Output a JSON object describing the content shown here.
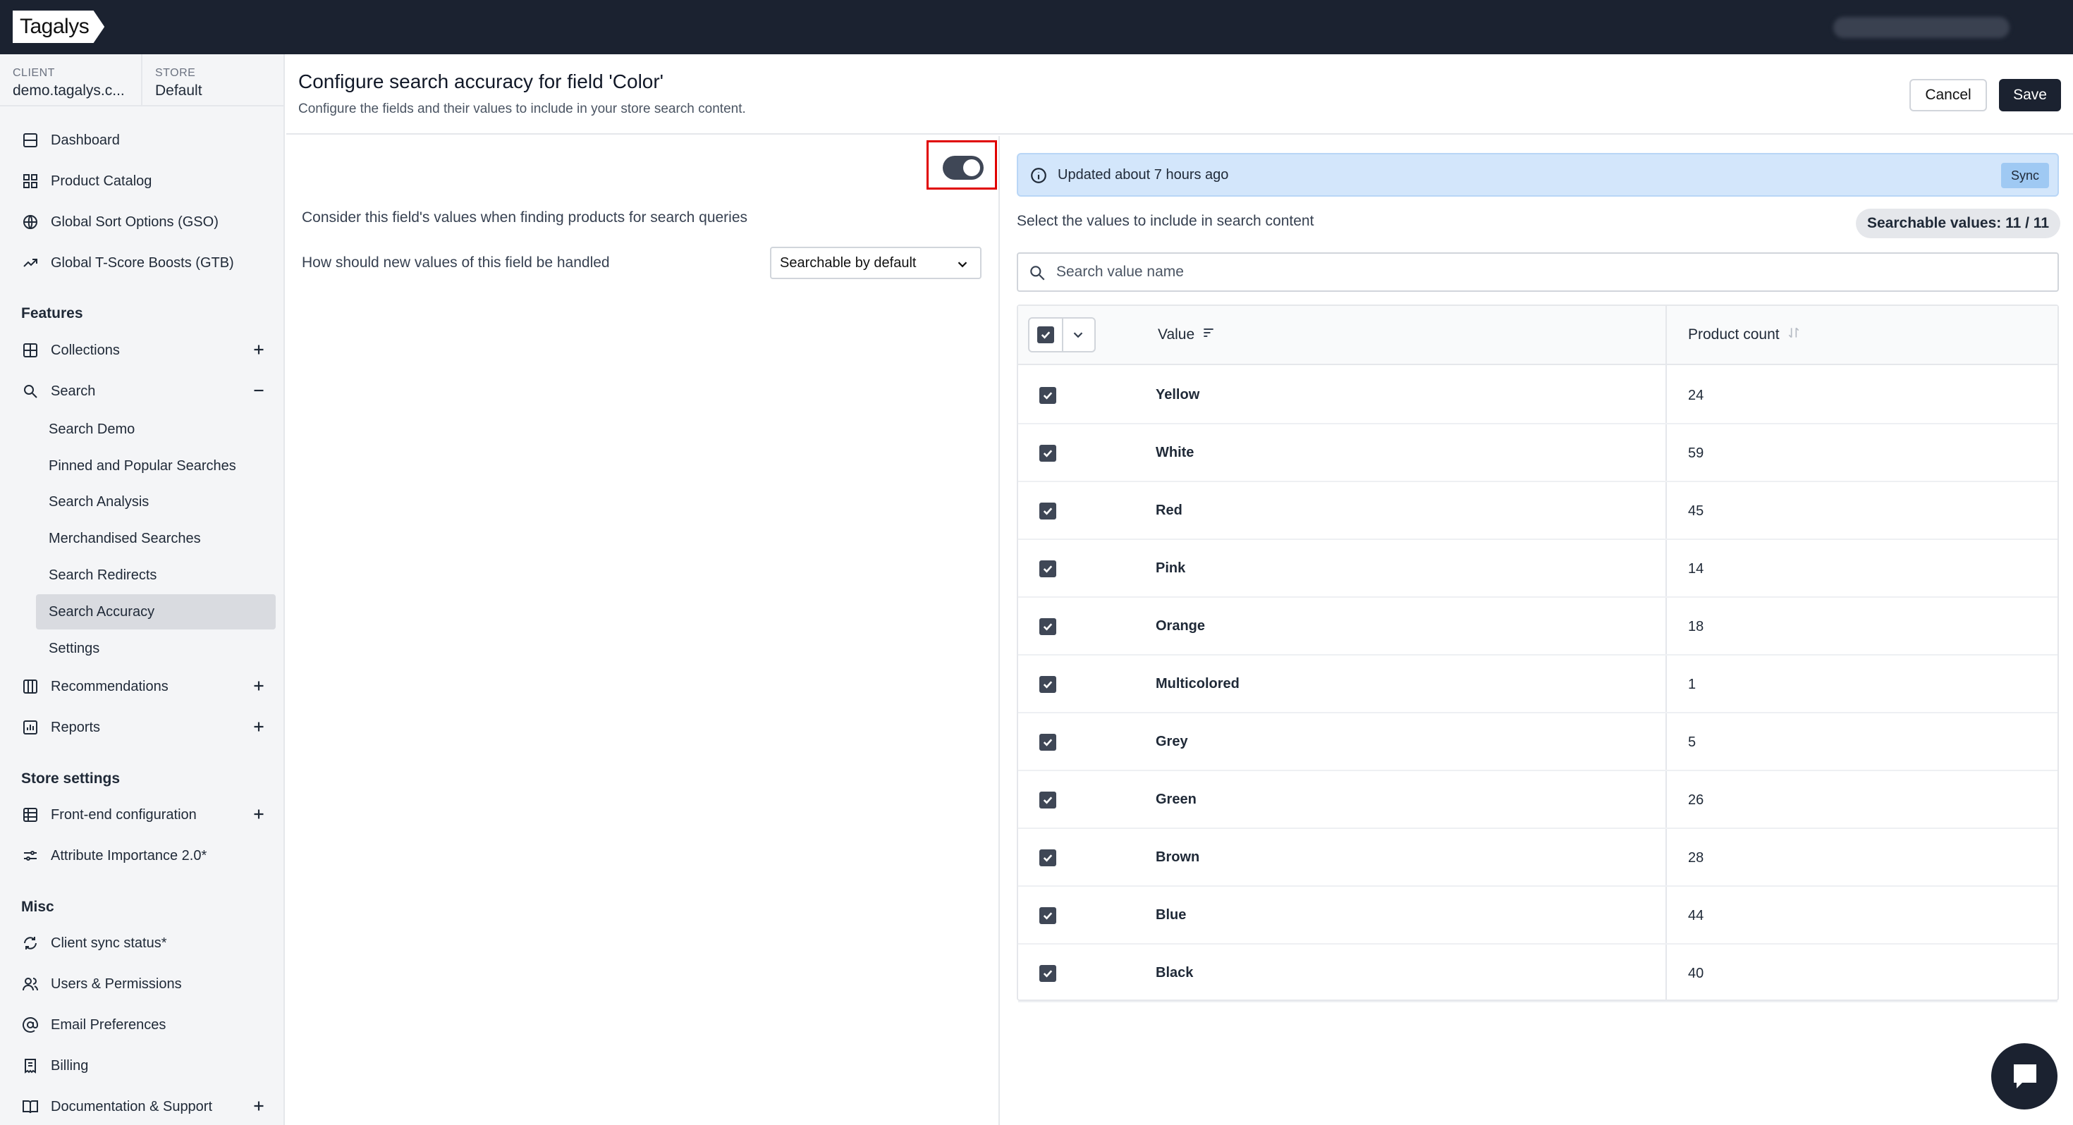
{
  "brand": {
    "logo": "Tagalys"
  },
  "context": {
    "client_label": "CLIENT",
    "client_value": "demo.tagalys.c...",
    "store_label": "STORE",
    "store_value": "Default"
  },
  "nav": {
    "top": [
      {
        "label": "Dashboard",
        "icon": "home-icon"
      },
      {
        "label": "Product Catalog",
        "icon": "grid-icon"
      },
      {
        "label": "Global Sort Options (GSO)",
        "icon": "globe-icon"
      },
      {
        "label": "Global T-Score Boosts (GTB)",
        "icon": "trend-icon"
      }
    ],
    "features_title": "Features",
    "features": [
      {
        "label": "Collections",
        "icon": "collections-icon"
      },
      {
        "label": "Search",
        "icon": "search-icon"
      },
      {
        "label": "Recommendations",
        "icon": "columns-icon"
      },
      {
        "label": "Reports",
        "icon": "chart-icon"
      }
    ],
    "search_sub": [
      "Search Demo",
      "Pinned and Popular Searches",
      "Search Analysis",
      "Merchandised Searches",
      "Search Redirects",
      "Search Accuracy",
      "Settings"
    ],
    "active_sub": "Search Accuracy",
    "store_title": "Store settings",
    "store": [
      {
        "label": "Front-end configuration",
        "icon": "globe-grid-icon"
      },
      {
        "label": "Attribute Importance 2.0*",
        "icon": "sliders-icon"
      }
    ],
    "misc_title": "Misc",
    "misc": [
      {
        "label": "Client sync status*",
        "icon": "sync-icon"
      },
      {
        "label": "Users & Permissions",
        "icon": "users-icon"
      },
      {
        "label": "Email Preferences",
        "icon": "at-icon"
      },
      {
        "label": "Billing",
        "icon": "billing-icon"
      },
      {
        "label": "Documentation & Support",
        "icon": "book-icon"
      }
    ]
  },
  "header": {
    "title": "Configure search accuracy for field 'Color'",
    "subtitle": "Configure the fields and their values to include in your store search content.",
    "cancel": "Cancel",
    "save": "Save"
  },
  "options": {
    "consider_label": "Consider this field's values when finding products for search queries",
    "consider_enabled": true,
    "new_values_label": "How should new values of this field be handled",
    "new_values_selected": "Searchable by default"
  },
  "values_panel": {
    "info_text": "Updated about 7 hours ago",
    "sync_label": "Sync",
    "select_label": "Select the values to include in search content",
    "badge": "Searchable values: 11 / 11",
    "search_placeholder": "Search value name",
    "col_value": "Value",
    "col_count": "Product count",
    "rows": [
      {
        "value": "Yellow",
        "count": "24",
        "checked": true
      },
      {
        "value": "White",
        "count": "59",
        "checked": true
      },
      {
        "value": "Red",
        "count": "45",
        "checked": true
      },
      {
        "value": "Pink",
        "count": "14",
        "checked": true
      },
      {
        "value": "Orange",
        "count": "18",
        "checked": true
      },
      {
        "value": "Multicolored",
        "count": "1",
        "checked": true
      },
      {
        "value": "Grey",
        "count": "5",
        "checked": true
      },
      {
        "value": "Green",
        "count": "26",
        "checked": true
      },
      {
        "value": "Brown",
        "count": "28",
        "checked": true
      },
      {
        "value": "Blue",
        "count": "44",
        "checked": true
      },
      {
        "value": "Black",
        "count": "40",
        "checked": true
      }
    ]
  },
  "colors": {
    "topbar": "#1b2230",
    "accent": "#3f4756",
    "info_bg": "#d3e6fb",
    "highlight": "#e00000"
  }
}
